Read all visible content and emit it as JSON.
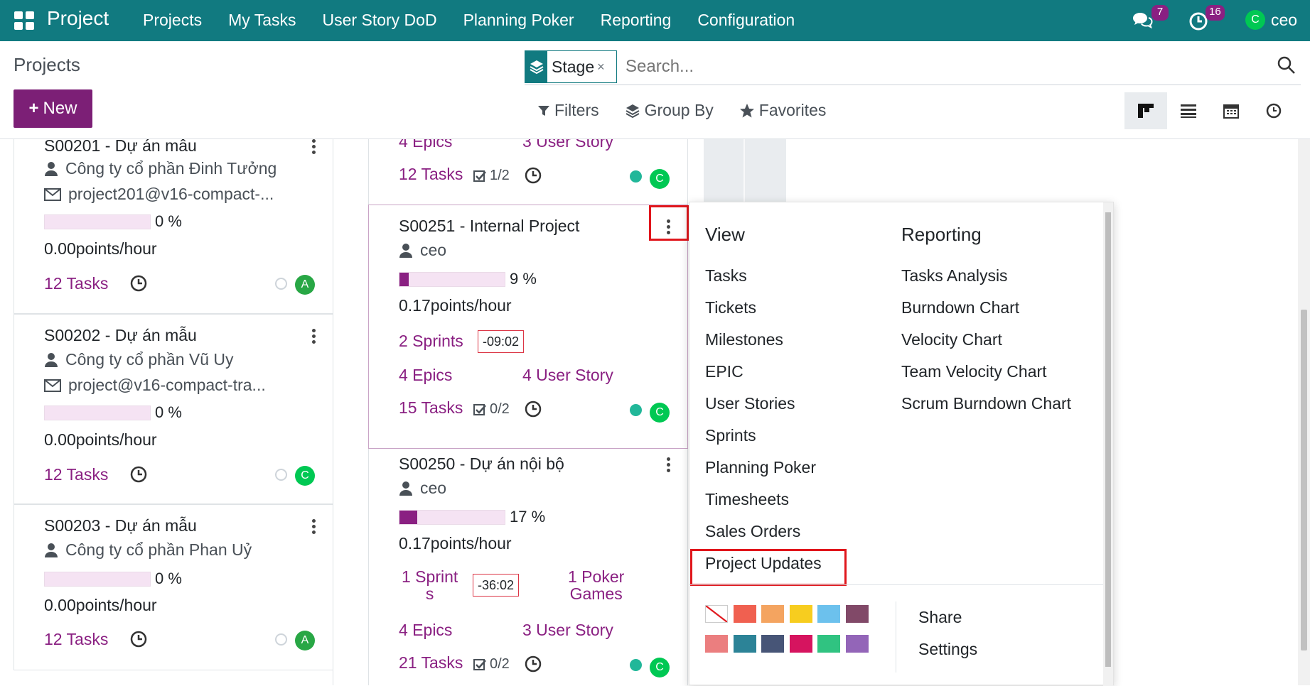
{
  "navbar": {
    "brand": "Project",
    "menu": [
      "Projects",
      "My Tasks",
      "User Story DoD",
      "Planning Poker",
      "Reporting",
      "Configuration"
    ],
    "messages_badge": "7",
    "activities_badge": "16",
    "user_initial": "C",
    "user_name": "ceo"
  },
  "control": {
    "breadcrumb": "Projects",
    "new_label": "New",
    "facet_label": "Stage",
    "search_placeholder": "Search...",
    "filters_label": "Filters",
    "groupby_label": "Group By",
    "favorites_label": "Favorites"
  },
  "left_cards": [
    {
      "title": "S00201 - Dự án mẫu",
      "company": "Công ty cổ phần Đinh Tưởng",
      "email": "project201@v16-compact-...",
      "progress": "0 %",
      "progress_value": 0,
      "pph": "0.00points/hour",
      "tasks": "12 Tasks",
      "avatar": "A"
    },
    {
      "title": "S00202 - Dự án mẫu",
      "company": "Công ty cổ phần Vũ Uy",
      "email": "project@v16-compact-tra...",
      "progress": "0 %",
      "progress_value": 0,
      "pph": "0.00points/hour",
      "tasks": "12 Tasks",
      "avatar": "C"
    },
    {
      "title": "S00203 - Dự án mẫu",
      "company": "Công ty cổ phần Phan Uỷ",
      "progress": "0 %",
      "progress_value": 0,
      "pph": "0.00points/hour",
      "tasks": "12 Tasks",
      "avatar": "A"
    }
  ],
  "middle_top": {
    "epics": "4 Epics",
    "user_story": "3 User Story",
    "tasks": "12 Tasks",
    "subtasks": "1/2",
    "avatar": "C"
  },
  "middle_card_1": {
    "title": "S00251 - Internal Project",
    "owner": "ceo",
    "progress": "9 %",
    "progress_value": 9,
    "pph": "0.17points/hour",
    "sprints": "2 Sprints",
    "deadline": "-09:02",
    "epics": "4 Epics",
    "user_story": "4 User Story",
    "tasks": "15 Tasks",
    "subtasks": "0/2",
    "avatar": "C"
  },
  "middle_card_2": {
    "title": "S00250 - Dự án nội bộ",
    "owner": "ceo",
    "progress": "17 %",
    "progress_value": 17,
    "pph": "0.17points/hour",
    "sprint_line1": "1 Sprint",
    "sprint_line2": "s",
    "deadline": "-36:02",
    "poker_line1": "1 Poker",
    "poker_line2": "Games",
    "epics": "4 Epics",
    "user_story": "3 User Story",
    "tasks": "21 Tasks",
    "subtasks": "0/2",
    "avatar": "C"
  },
  "dropdown": {
    "view_header": "View",
    "view_items": [
      "Tasks",
      "Tickets",
      "Milestones",
      "EPIC",
      "User Stories",
      "Sprints",
      "Planning Poker",
      "Timesheets",
      "Sales Orders",
      "Project Updates"
    ],
    "reporting_header": "Reporting",
    "reporting_items": [
      "Tasks Analysis",
      "Burndown Chart",
      "Velocity Chart",
      "Team Velocity Chart",
      "Scrum Burndown Chart"
    ],
    "share_label": "Share",
    "settings_label": "Settings",
    "colors": [
      "none",
      "#f06050",
      "#f4a460",
      "#f7cd1f",
      "#6cc1ed",
      "#814968",
      "#eb7e7f",
      "#2c8397",
      "#475577",
      "#d6145f",
      "#30c381",
      "#9365b8"
    ]
  }
}
